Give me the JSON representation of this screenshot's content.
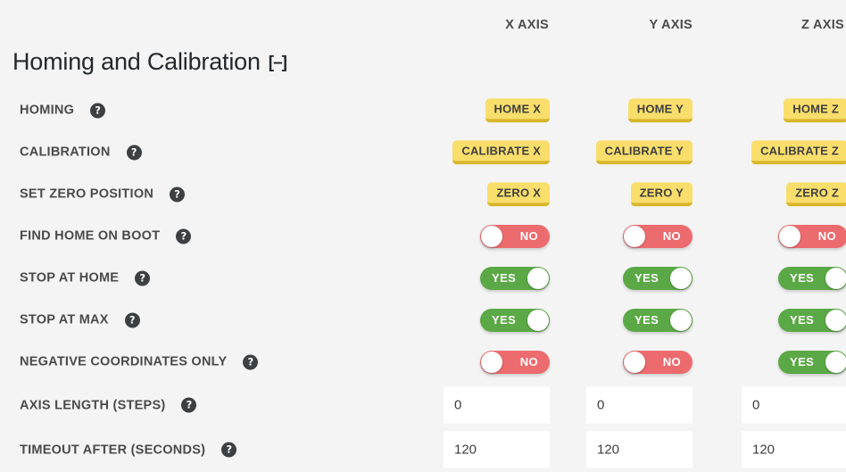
{
  "header": {
    "columns": [
      {
        "label": "X AXIS"
      },
      {
        "label": "Y AXIS"
      },
      {
        "label": "Z AXIS"
      }
    ]
  },
  "section": {
    "title": "Homing and Calibration",
    "collapse_label": "[–]"
  },
  "help_icon": "?",
  "rows": [
    {
      "label": "HOMING",
      "type": "button",
      "cells": [
        {
          "label": "HOME X"
        },
        {
          "label": "HOME Y"
        },
        {
          "label": "HOME Z"
        }
      ]
    },
    {
      "label": "CALIBRATION",
      "type": "button",
      "cells": [
        {
          "label": "CALIBRATE X"
        },
        {
          "label": "CALIBRATE Y"
        },
        {
          "label": "CALIBRATE Z"
        }
      ]
    },
    {
      "label": "SET ZERO POSITION",
      "type": "button",
      "cells": [
        {
          "label": "ZERO X"
        },
        {
          "label": "ZERO Y"
        },
        {
          "label": "ZERO Z"
        }
      ]
    },
    {
      "label": "FIND HOME ON BOOT",
      "type": "toggle",
      "cells": [
        {
          "state": "off",
          "label": "NO"
        },
        {
          "state": "off",
          "label": "NO"
        },
        {
          "state": "off",
          "label": "NO"
        }
      ]
    },
    {
      "label": "STOP AT HOME",
      "type": "toggle",
      "cells": [
        {
          "state": "on",
          "label": "YES"
        },
        {
          "state": "on",
          "label": "YES"
        },
        {
          "state": "on",
          "label": "YES"
        }
      ]
    },
    {
      "label": "STOP AT MAX",
      "type": "toggle",
      "cells": [
        {
          "state": "on",
          "label": "YES"
        },
        {
          "state": "on",
          "label": "YES"
        },
        {
          "state": "on",
          "label": "YES"
        }
      ]
    },
    {
      "label": "NEGATIVE COORDINATES ONLY",
      "type": "toggle",
      "cells": [
        {
          "state": "off",
          "label": "NO"
        },
        {
          "state": "off",
          "label": "NO"
        },
        {
          "state": "on",
          "label": "YES"
        }
      ]
    },
    {
      "label": "AXIS LENGTH (STEPS)",
      "type": "input",
      "cells": [
        {
          "value": "0"
        },
        {
          "value": "0"
        },
        {
          "value": "0"
        }
      ]
    },
    {
      "label": "TIMEOUT AFTER (SECONDS)",
      "type": "input",
      "cells": [
        {
          "value": "120"
        },
        {
          "value": "120"
        },
        {
          "value": "120"
        }
      ]
    }
  ],
  "colors": {
    "background": "#f4f4f4",
    "button": "#f9de6c",
    "button_shadow": "#d8b62b",
    "toggle_on": "#5ba946",
    "toggle_off": "#ec6b6e",
    "text": "#4a4a4a",
    "title": "#23282d"
  }
}
